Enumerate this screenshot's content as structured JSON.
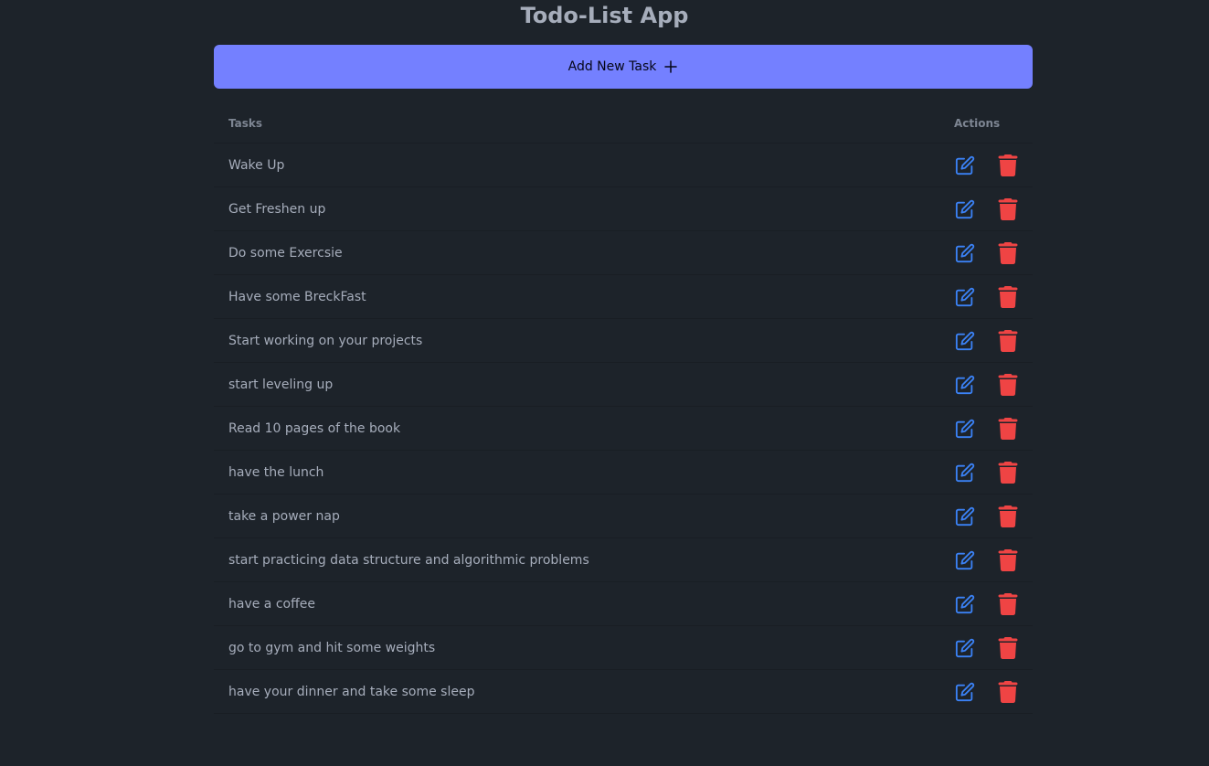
{
  "app": {
    "title": "Todo-List App"
  },
  "add_button": {
    "label": "Add New Task",
    "icon": "plus-icon"
  },
  "table": {
    "headers": {
      "tasks": "Tasks",
      "actions": "Actions"
    },
    "rows": [
      {
        "task": "Wake Up"
      },
      {
        "task": "Get Freshen up"
      },
      {
        "task": "Do some Exercsie"
      },
      {
        "task": "Have some BreckFast"
      },
      {
        "task": "Start working on your projects"
      },
      {
        "task": "start leveling up"
      },
      {
        "task": "Read 10 pages of the book"
      },
      {
        "task": "have the lunch"
      },
      {
        "task": "take a power nap"
      },
      {
        "task": "start practicing data structure and algorithmic problems"
      },
      {
        "task": "have a coffee"
      },
      {
        "task": "go to gym and hit some weights"
      },
      {
        "task": "have your dinner and take some sleep"
      }
    ],
    "row_actions": {
      "edit_icon": "edit-icon",
      "delete_icon": "trash-icon"
    }
  },
  "colors": {
    "background": "#1d232a",
    "primary": "#7480ff",
    "edit": "#3b82f6",
    "delete": "#ef4444",
    "text": "#a6adbb"
  }
}
